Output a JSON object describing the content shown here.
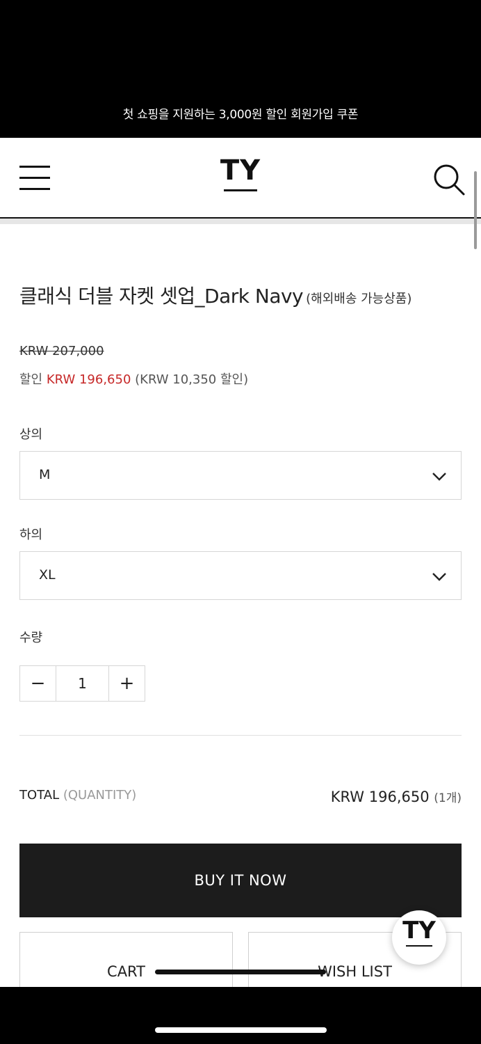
{
  "promo": {
    "text": "첫 쇼핑을 지원하는 3,000원 할인 회원가입 쿠폰"
  },
  "header": {
    "logo": "TY"
  },
  "product": {
    "title": "클래식 더블 자켓 셋업_Dark Navy",
    "note": "(해외배송 가능상품)",
    "original_price": "KRW 207,000",
    "discount_prefix": "할인",
    "sale_price": "KRW 196,650",
    "discount_amount": "(KRW 10,350 할인)"
  },
  "options": {
    "top_label": "상의",
    "top_value": "M",
    "bottom_label": "하의",
    "bottom_value": "XL",
    "qty_label": "수량",
    "qty_minus": "−",
    "qty_value": "1",
    "qty_plus": "+"
  },
  "total": {
    "label": "TOTAL",
    "label_sub": "(QUANTITY)",
    "price": "KRW 196,650",
    "count": "(1개)"
  },
  "actions": {
    "buy_now": "BUY IT NOW",
    "cart": "CART",
    "wish_list": "WISH LIST"
  },
  "fab": {
    "text": "TY"
  },
  "icons": [
    "hamburger-icon",
    "search-icon",
    "chevron-down-icon"
  ],
  "colors": {
    "accent_sale": "#c62828",
    "button_dark": "#1c1c1c"
  }
}
